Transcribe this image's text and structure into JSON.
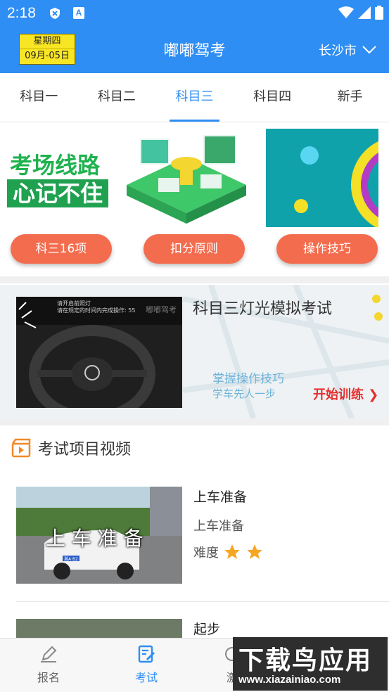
{
  "status_bar": {
    "time": "2:18",
    "icon_b_letter": "A"
  },
  "header": {
    "weekday": "星期四",
    "date": "09月-05日",
    "title": "嘟嘟驾考",
    "city": "长沙市"
  },
  "tabs": [
    {
      "label": "科目一",
      "active": false
    },
    {
      "label": "科目二",
      "active": false
    },
    {
      "label": "科目三",
      "active": true
    },
    {
      "label": "科目四",
      "active": false
    },
    {
      "label": "新手",
      "active": false
    }
  ],
  "banner": {
    "card_line1": "考场线路",
    "card_line2": "心记不住",
    "buttons": [
      "科三16项",
      "扣分原则",
      "操作技巧"
    ]
  },
  "light_sim": {
    "title": "科目三灯光模拟考试",
    "sub1": "掌握操作技巧",
    "sub2": "学车先人一步",
    "start_label": "开始训练 ❯",
    "screen_line1": "请开启前照灯",
    "screen_line2": "请在规定的时间内完成操作: 55",
    "screen_logo": "嘟嘟驾考"
  },
  "video_section": {
    "title": "考试项目视频",
    "items": [
      {
        "title": "上车准备",
        "subtitle": "上车准备",
        "difficulty_label": "难度",
        "stars": 2,
        "thumb_caption": "上 车 准 备",
        "plate": "湘A·B2"
      },
      {
        "title": "起步"
      }
    ]
  },
  "bottom_nav": [
    {
      "label": "报名",
      "active": false
    },
    {
      "label": "考试",
      "active": true
    },
    {
      "label": "激",
      "active": false
    }
  ],
  "watermark": {
    "big": "下载鸟应用",
    "small": "www.xiazainiao.com"
  },
  "colors": {
    "primary": "#2f8ef4",
    "pill": "#f36c4e",
    "star": "#f5a623",
    "accent_red": "#e52f2f"
  }
}
